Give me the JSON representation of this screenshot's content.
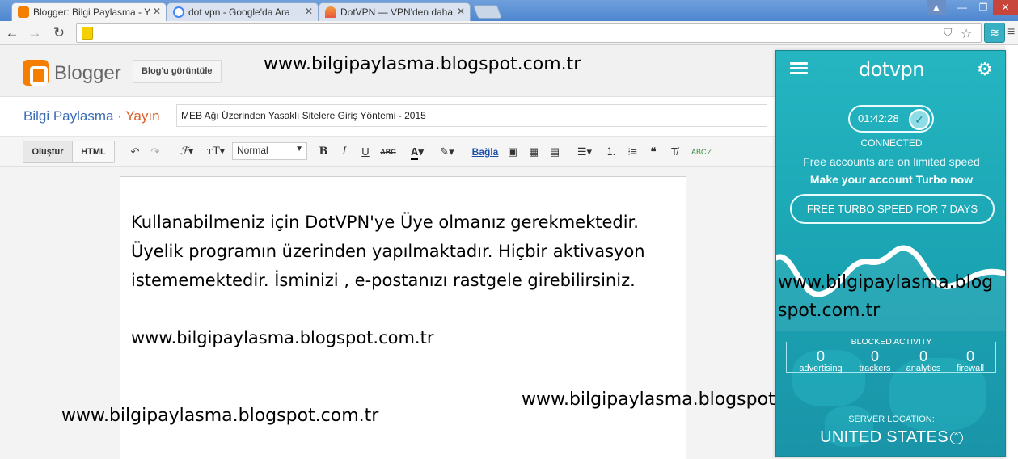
{
  "browser": {
    "tabs": [
      {
        "label": "Blogger: Bilgi Paylasma - Y",
        "color": "#f57d00"
      },
      {
        "label": "dot vpn - Google'da Ara",
        "color": "#4285f4"
      },
      {
        "label": "DotVPN — VPN'den daha",
        "color": "#e8563f"
      }
    ]
  },
  "blogger": {
    "brand": "Blogger",
    "view_blog_button": "Blog'u görüntüle",
    "blog_name": "Bilgi Paylasma",
    "separator": " · ",
    "publish": "Yayın",
    "post_title": "MEB Ağı Üzerinden Yasaklı Sitelere Giriş Yöntemi - 2015"
  },
  "editor": {
    "mode_compose": "Oluştur",
    "mode_html": "HTML",
    "format_value": "Normal",
    "link_label": "Bağla",
    "body_lines": [
      "Kullanabilmeniz için DotVPN'ye Üye olmanız gerekmektedir.",
      "Üyelik programın üzerinden yapılmaktadır. Hiçbir aktivasyon",
      "istememektedir. İsminizi , e-postanızı rastgele girebilirsiniz.",
      "www.bilgipaylasma.blogspot.com.tr"
    ]
  },
  "watermark": {
    "text": "www.bilgipaylasma.blogspot.com.tr",
    "split_line1": "www.bilgipaylasma.blog",
    "split_line2": "spot.com.tr"
  },
  "vpn": {
    "logo": "dotvpn",
    "timer": "01:42:28",
    "status": "CONNECTED",
    "free_note": "Free accounts are on limited speed",
    "turbo_note": "Make your account Turbo now",
    "turbo_button": "FREE TURBO SPEED FOR 7 DAYS",
    "blocked_title": "BLOCKED ACTIVITY",
    "blocked": [
      {
        "label": "advertising",
        "value": "0"
      },
      {
        "label": "trackers",
        "value": "0"
      },
      {
        "label": "analytics",
        "value": "0"
      },
      {
        "label": "firewall",
        "value": "0"
      }
    ],
    "server_label": "SERVER LOCATION:",
    "server_value": "UNITED STATES",
    "accent": "#21a6b4"
  }
}
